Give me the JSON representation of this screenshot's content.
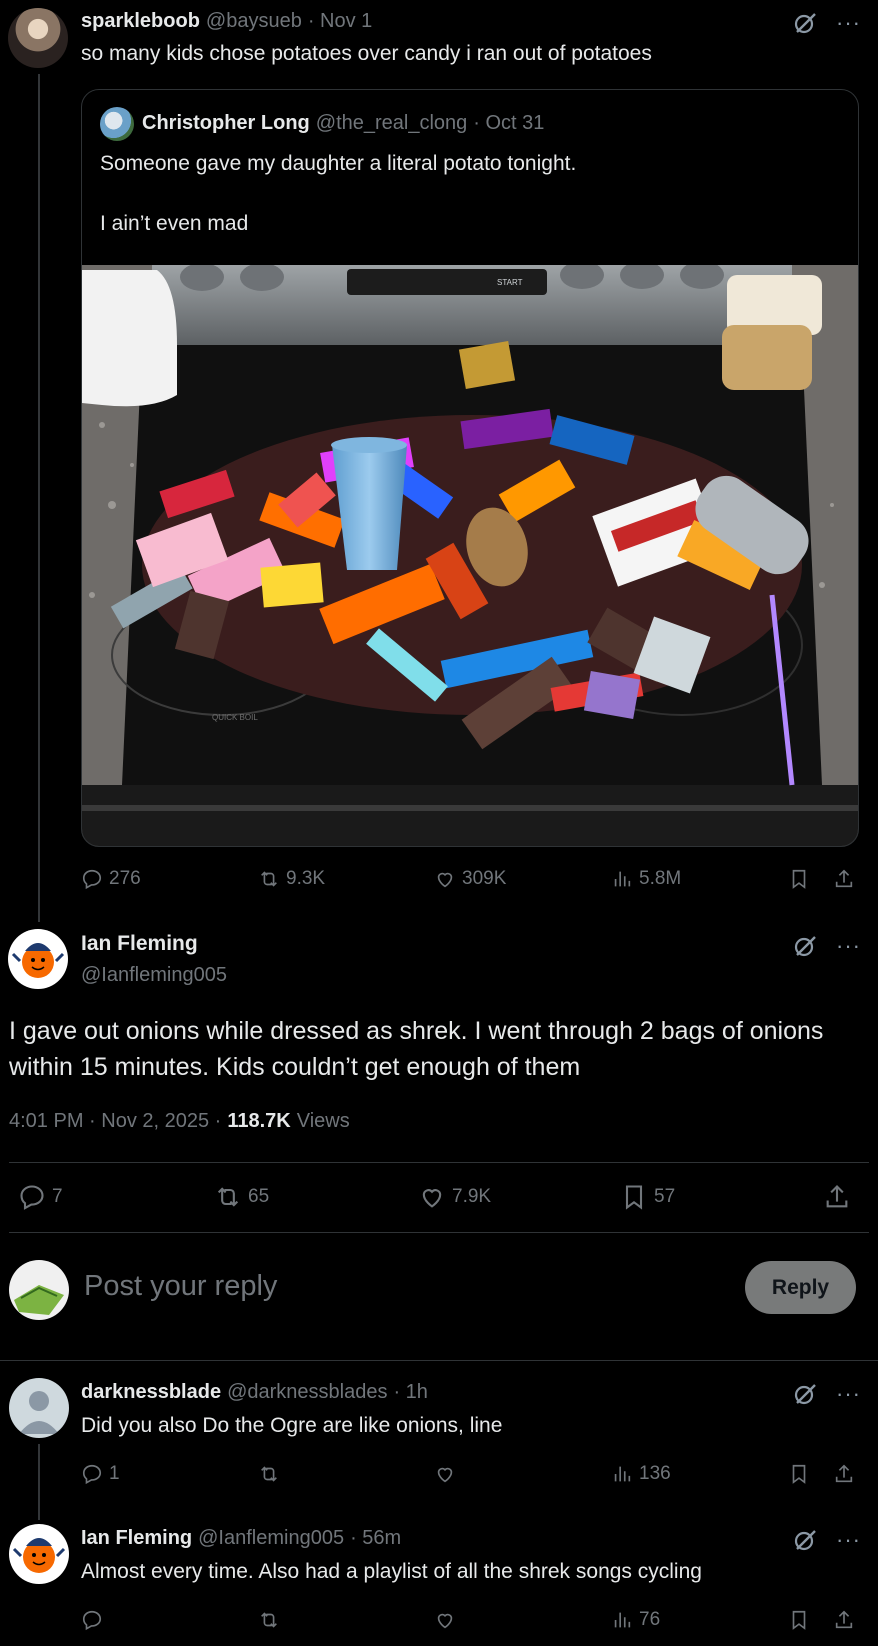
{
  "parent_post": {
    "display_name": "sparkleboob",
    "handle": "@baysueb",
    "date": "· Nov 1",
    "text": "so many kids chose potatoes over candy i ran out of potatoes",
    "quote": {
      "display_name": "Christopher Long",
      "handle": "@the_real_clong",
      "date": "· Oct 31",
      "line1": "Someone gave my daughter a literal potato tonight.",
      "line2": "I ain’t even mad",
      "image_stove_label": "QUICK BOIL",
      "image_start_label": "START"
    },
    "actions": {
      "replies": "276",
      "reposts": "9.3K",
      "likes": "309K",
      "views": "5.8M"
    }
  },
  "main_post": {
    "display_name": "Ian Fleming",
    "handle": "@Ianfleming005",
    "text": "I gave out onions while dressed as shrek. I went through 2 bags of onions within 15 minutes. Kids couldn’t get enough of them",
    "timestamp": "4:01 PM · Nov 2, 2025 ·",
    "views_count": "118.7K",
    "views_label": "Views",
    "actions": {
      "replies": "7",
      "reposts": "65",
      "likes": "7.9K",
      "bookmarks": "57"
    }
  },
  "composer": {
    "placeholder": "Post your reply",
    "reply_button": "Reply"
  },
  "replies": [
    {
      "display_name": "darknessblade",
      "handle": "@darknessblades",
      "date": "· 1h",
      "text": "Did you also Do the Ogre are like onions, line",
      "replies": "1",
      "views": "136"
    },
    {
      "display_name": "Ian Fleming",
      "handle": "@Ianfleming005",
      "date": "· 56m",
      "text": "Almost every time. Also had a playlist of all the shrek songs cycling",
      "replies": "",
      "views": "76"
    }
  ],
  "icons": {
    "grok": "grok-icon",
    "more": "more-icon",
    "reply": "reply-icon",
    "repost": "repost-icon",
    "like": "like-icon",
    "views": "views-icon",
    "bookmark": "bookmark-icon",
    "share": "share-icon"
  },
  "colors": {
    "background": "#000000",
    "text": "#e7e9ea",
    "muted": "#71767b",
    "divider": "#2f3336",
    "reply_button_bg": "#787a7a"
  }
}
